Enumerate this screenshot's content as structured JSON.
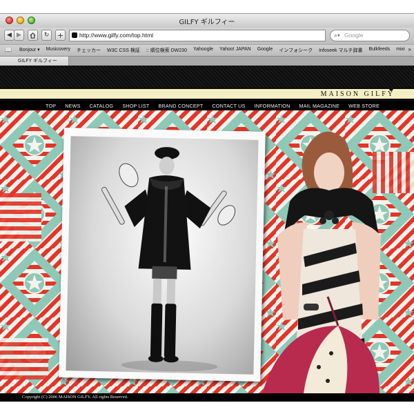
{
  "window": {
    "title": "GILFY ギルフィー"
  },
  "toolbar": {
    "back_icon": "back-arrow-icon",
    "forward_icon": "forward-arrow-icon",
    "home_icon": "home-icon",
    "reload_icon": "reload-icon",
    "add_icon": "plus-icon",
    "url": "http://www.gilfy.com/top.html",
    "search_placeholder": "Google"
  },
  "bookmarks": [
    "Bonjour ▾",
    "Musicovery",
    "チェッカー",
    "W3C CSS 検証",
    ":: 順位検索 DW230",
    "Yahoogle",
    "Yahoo! JAPAN",
    "Google",
    "インフォシーク",
    "Infoseek マルチ辞書",
    "Bulkfeeds",
    "mixi"
  ],
  "bookmarks_more": "»",
  "tab": {
    "label": "GILFY ギルフィー"
  },
  "site": {
    "logo": "MAISON GILFY",
    "nav": [
      "TOP",
      "NEWS",
      "CATALOG",
      "SHOP LIST",
      "BRAND CONCEPT",
      "CONTACT US",
      "INFORMATION",
      "MAIL MAGAZINE",
      "WEB STORE"
    ],
    "copyright": "Copyright (C) 2006 MAISON GILFY. All rights Reserved."
  },
  "colors": {
    "pattern_red": "#e33528",
    "pattern_teal": "#8ec9b8",
    "pattern_white": "#f6f3ee",
    "brand_bar": "#f3efc2",
    "nav_bg": "#000000"
  }
}
